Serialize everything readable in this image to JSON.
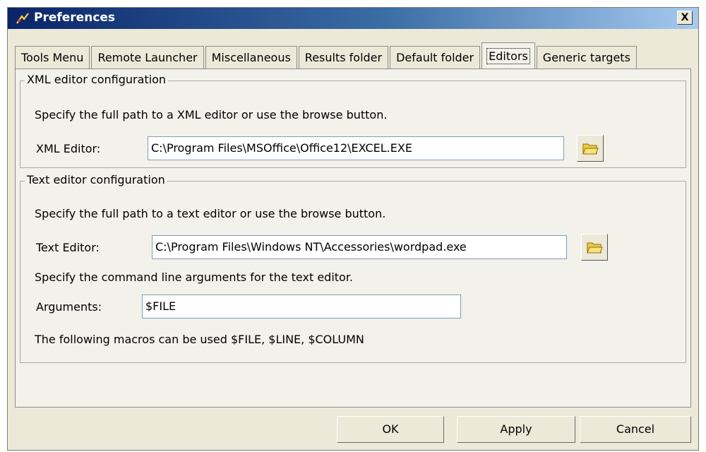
{
  "window": {
    "title": "Preferences",
    "close_label": "X"
  },
  "tabs": [
    {
      "label": "Tools Menu"
    },
    {
      "label": "Remote Launcher"
    },
    {
      "label": "Miscellaneous"
    },
    {
      "label": "Results folder"
    },
    {
      "label": "Default folder"
    },
    {
      "label": "Editors",
      "active": true
    },
    {
      "label": "Generic targets"
    }
  ],
  "xml_group": {
    "title": "XML editor configuration",
    "instruction": "Specify the full path to a XML editor or use the browse button.",
    "label": "XML Editor:",
    "value": "C:\\Program Files\\MSOffice\\Office12\\EXCEL.EXE"
  },
  "text_group": {
    "title": "Text editor configuration",
    "instruction": "Specify the full path to a text editor or use the browse button.",
    "label": "Text Editor:",
    "value": "C:\\Program Files\\Windows NT\\Accessories\\wordpad.exe",
    "args_instruction": "Specify the command line arguments for the text editor.",
    "args_label": "Arguments:",
    "args_value": "$FILE",
    "macros_note": "The following macros can be used $FILE, $LINE, $COLUMN"
  },
  "buttons": {
    "ok": "OK",
    "apply": "Apply",
    "cancel": "Cancel"
  },
  "icons": {
    "title_icon": "app-logo-icon",
    "browse_icon": "folder-open-icon"
  }
}
